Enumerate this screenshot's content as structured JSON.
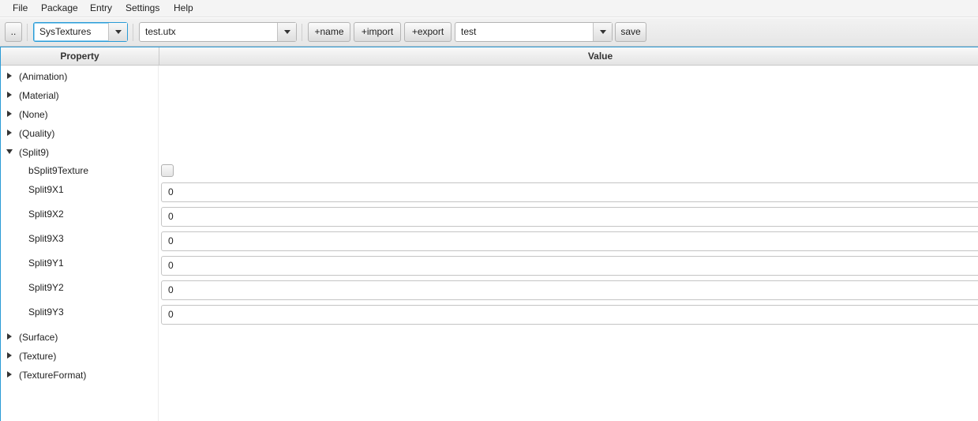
{
  "menu": [
    "File",
    "Package",
    "Entry",
    "Settings",
    "Help"
  ],
  "toolbar": {
    "up_label": "..",
    "group_combo": "SysTextures",
    "file_combo": "test.utx",
    "add_name_label": "+name",
    "import_label": "+import",
    "export_label": "+export",
    "entry_combo": "test",
    "save_label": "save"
  },
  "table": {
    "property_header": "Property",
    "value_header": "Value"
  },
  "categories_before": [
    "(Animation)",
    "(Material)",
    "(None)",
    "(Quality)"
  ],
  "expanded_category": "(Split9)",
  "split9": {
    "checkbox_label": "bSplit9Texture",
    "fields": [
      {
        "label": "Split9X1",
        "value": "0"
      },
      {
        "label": "Split9X2",
        "value": "0"
      },
      {
        "label": "Split9X3",
        "value": "0"
      },
      {
        "label": "Split9Y1",
        "value": "0"
      },
      {
        "label": "Split9Y2",
        "value": "0"
      },
      {
        "label": "Split9Y3",
        "value": "0"
      }
    ]
  },
  "categories_after": [
    "(Surface)",
    "(Texture)",
    "(TextureFormat)"
  ],
  "colors": {
    "focus_accent": "#2a9bd6"
  }
}
